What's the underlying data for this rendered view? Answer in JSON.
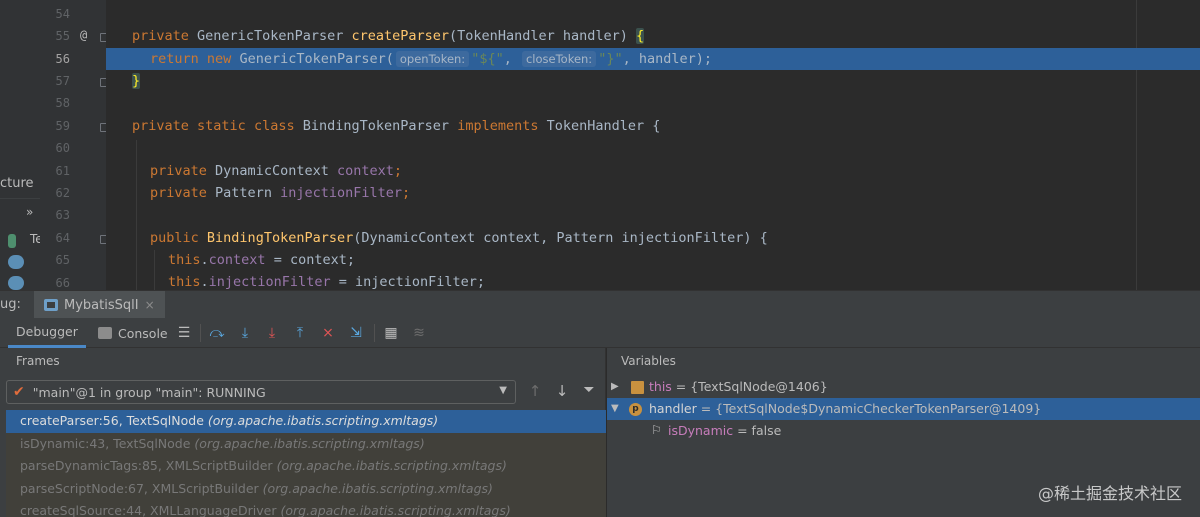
{
  "editor": {
    "left_strip_label": "cture",
    "left_strip_chevron": "»",
    "left_strip_item": "Te",
    "lines": [
      {
        "n": "54"
      },
      {
        "n": "55",
        "marker": "@"
      },
      {
        "n": "56"
      },
      {
        "n": "57"
      },
      {
        "n": "58"
      },
      {
        "n": "59"
      },
      {
        "n": "60"
      },
      {
        "n": "61"
      },
      {
        "n": "62"
      },
      {
        "n": "63"
      },
      {
        "n": "64"
      },
      {
        "n": "65"
      },
      {
        "n": "66"
      }
    ],
    "code": {
      "l55": {
        "kw1": "private",
        "type": "GenericTokenParser",
        "method": "createParser",
        "params": "(TokenHandler handler) ",
        "brace": "{"
      },
      "l56": {
        "kw1": "return",
        "kw2": "new",
        "ctor": "GenericTokenParser(",
        "hint1": "openToken:",
        "str1": "\"${\"",
        "comma1": ", ",
        "hint2": "closeToken:",
        "str2": "\"}\"",
        "rest": ", handler);"
      },
      "l57": {
        "brace": "}"
      },
      "l59": {
        "kw1": "private",
        "kw2": "static",
        "kw3": "class",
        "name": "BindingTokenParser",
        "kw4": "implements",
        "iface": "TokenHandler {"
      },
      "l61": {
        "kw1": "private",
        "type": "DynamicContext",
        "field": "context",
        "semi": ";"
      },
      "l62": {
        "kw1": "private",
        "type": "Pattern",
        "field": "injectionFilter",
        "semi": ";"
      },
      "l64": {
        "kw1": "public",
        "method": "BindingTokenParser",
        "params": "(DynamicContext context, Pattern injectionFilter) {"
      },
      "l65": {
        "kw1": "this",
        "dot": ".",
        "field": "context",
        "rest": " = context;"
      },
      "l66": {
        "kw1": "this",
        "dot": ".",
        "field": "injectionFilter",
        "rest": " = injectionFilter;"
      }
    }
  },
  "debug": {
    "window_label": "ug:",
    "run_tab": "MybatisSqlI",
    "run_tab_close": "×",
    "tabs": {
      "debugger": "Debugger",
      "console": "Console"
    },
    "icons": [
      "menu-icon",
      "step-over-icon",
      "step-into-icon",
      "force-step-into-icon",
      "step-out-icon",
      "drop-frame-icon",
      "run-to-cursor-icon",
      "evaluate-icon",
      "trace-icon"
    ],
    "frames": {
      "title": "Frames",
      "thread": "\"main\"@1 in group \"main\": RUNNING",
      "items": [
        {
          "method": "createParser:56, TextSqlNode",
          "pkg": "(org.apache.ibatis.scripting.xmltags)"
        },
        {
          "method": "isDynamic:43, TextSqlNode",
          "pkg": "(org.apache.ibatis.scripting.xmltags)"
        },
        {
          "method": "parseDynamicTags:85, XMLScriptBuilder",
          "pkg": "(org.apache.ibatis.scripting.xmltags)"
        },
        {
          "method": "parseScriptNode:67, XMLScriptBuilder",
          "pkg": "(org.apache.ibatis.scripting.xmltags)"
        },
        {
          "method": "createSqlSource:44, XMLLanguageDriver",
          "pkg": "(org.apache.ibatis.scripting.xmltags)"
        }
      ]
    },
    "variables": {
      "title": "Variables",
      "items": [
        {
          "name": "this",
          "eq": " = ",
          "value": "{TextSqlNode@1406}"
        },
        {
          "name": "handler",
          "eq": " = ",
          "value": "{TextSqlNode$DynamicCheckerTokenParser@1409}"
        },
        {
          "name": "isDynamic",
          "eq": " = ",
          "value": "false"
        }
      ]
    }
  },
  "watermark": "@稀土掘金技术社区",
  "colors": {
    "selection": "#2d6099",
    "keyword": "#cc7832",
    "method": "#ffc66d",
    "field": "#9876aa",
    "string": "#6a8759"
  }
}
